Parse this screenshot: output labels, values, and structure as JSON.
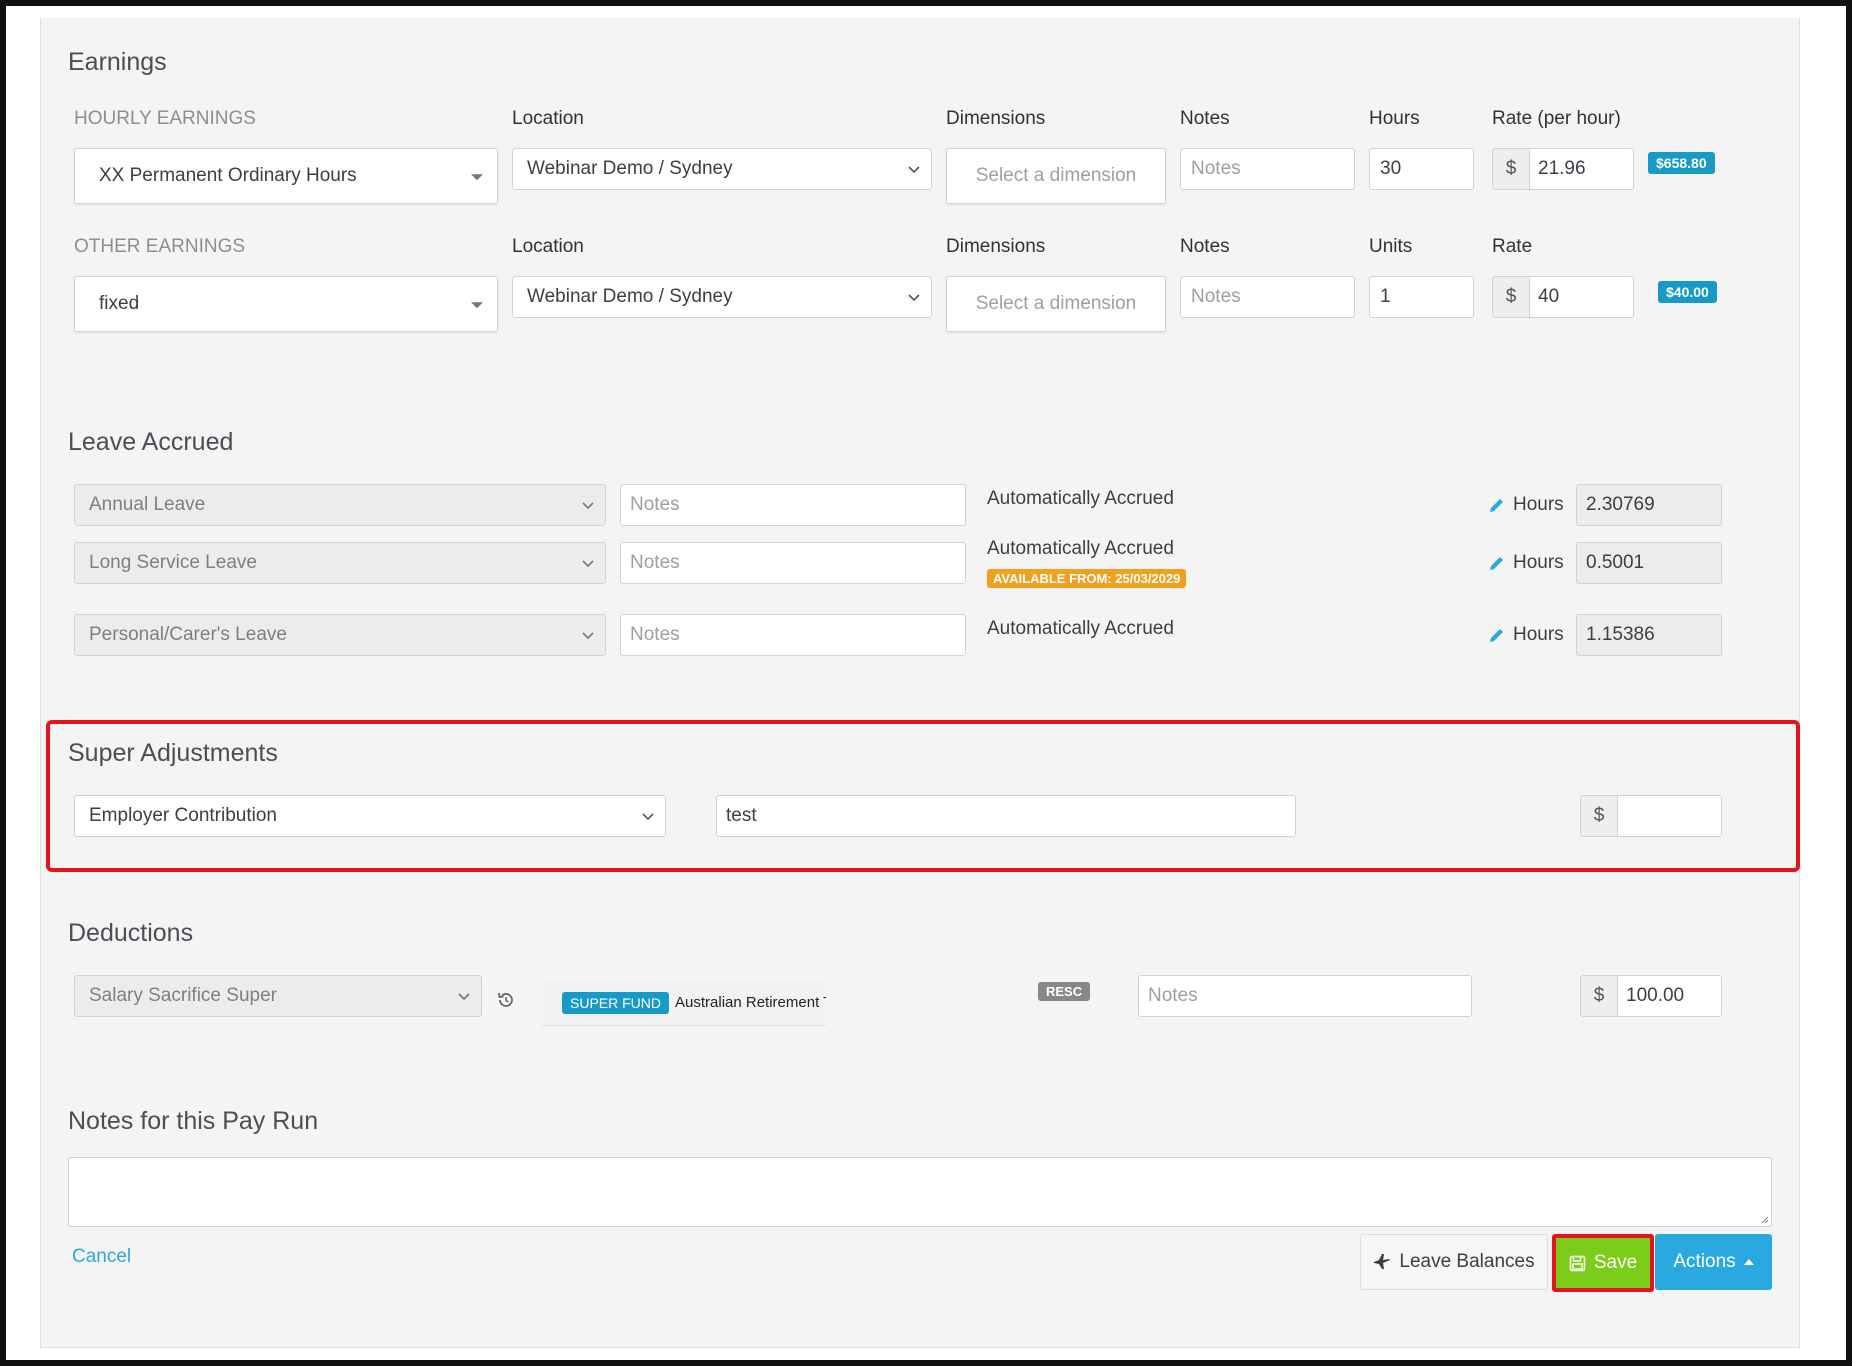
{
  "earnings": {
    "title": "Earnings",
    "hourly": {
      "section_label": "HOURLY EARNINGS",
      "headers": {
        "location": "Location",
        "dimensions": "Dimensions",
        "notes": "Notes",
        "hours": "Hours",
        "rate": "Rate (per hour)"
      },
      "type": "XX Permanent Ordinary Hours",
      "location": "Webinar Demo / Sydney",
      "dimension_placeholder": "Select a dimension",
      "notes_placeholder": "Notes",
      "hours": "30",
      "currency": "$",
      "rate": "21.96",
      "total": "$658.80"
    },
    "other": {
      "section_label": "OTHER EARNINGS",
      "headers": {
        "location": "Location",
        "dimensions": "Dimensions",
        "notes": "Notes",
        "units": "Units",
        "rate": "Rate"
      },
      "type": "fixed",
      "location": "Webinar Demo / Sydney",
      "dimension_placeholder": "Select a dimension",
      "notes_placeholder": "Notes",
      "units": "1",
      "currency": "$",
      "rate": "40",
      "total": "$40.00"
    }
  },
  "leave_accrued": {
    "title": "Leave Accrued",
    "hours_label": "Hours",
    "rows": [
      {
        "type": "Annual Leave",
        "notes_placeholder": "Notes",
        "status": "Automatically Accrued",
        "available": "",
        "hours": "2.30769"
      },
      {
        "type": "Long Service Leave",
        "notes_placeholder": "Notes",
        "status": "Automatically Accrued",
        "available": "AVAILABLE FROM: 25/03/2029",
        "hours": "0.5001"
      },
      {
        "type": "Personal/Carer's Leave",
        "notes_placeholder": "Notes",
        "status": "Automatically Accrued",
        "available": "",
        "hours": "1.15386"
      }
    ]
  },
  "super_adjustments": {
    "title": "Super Adjustments",
    "type": "Employer Contribution",
    "notes": "test",
    "currency": "$",
    "amount": ""
  },
  "deductions": {
    "title": "Deductions",
    "type": "Salary Sacrifice Super",
    "fund_tag": "SUPER FUND",
    "fund_name": "Australian Retirement T",
    "resc_badge": "RESC",
    "notes_placeholder": "Notes",
    "currency": "$",
    "amount": "100.00"
  },
  "pay_run_notes": {
    "title": "Notes for this Pay Run",
    "value": ""
  },
  "footer": {
    "cancel_label": "Cancel",
    "leave_balances_label": "Leave Balances",
    "save_label": "Save",
    "actions_label": "Actions"
  },
  "colors": {
    "accent": "#2aa8e0",
    "badge": "#179bc6",
    "save": "#7ccc1a",
    "highlight": "#e4141b",
    "warning": "#f0a21f"
  }
}
